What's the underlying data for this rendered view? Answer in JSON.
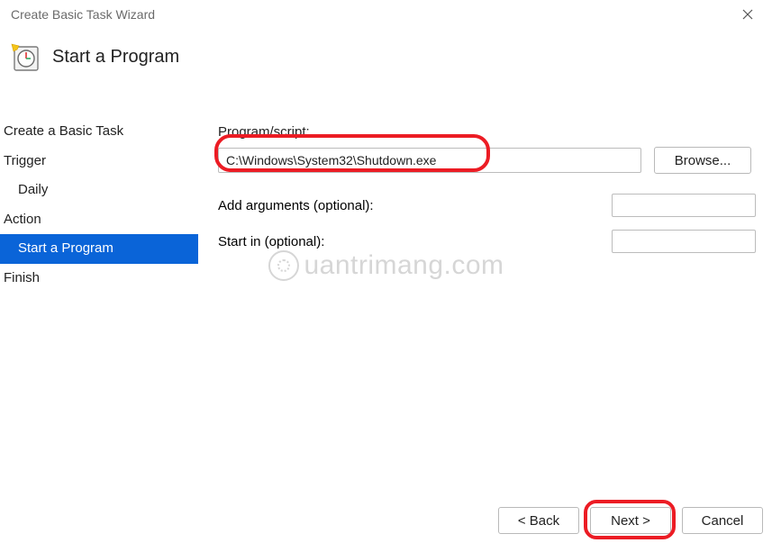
{
  "window": {
    "title": "Create Basic Task Wizard"
  },
  "header": {
    "title": "Start a Program"
  },
  "sidebar": {
    "items": {
      "create": "Create a Basic Task",
      "trigger": "Trigger",
      "trigger_sub": "Daily",
      "action": "Action",
      "action_sub": "Start a Program",
      "finish": "Finish"
    }
  },
  "form": {
    "program_label": "Program/script:",
    "program_value": "C:\\Windows\\System32\\Shutdown.exe",
    "browse_label": "Browse...",
    "arguments_label": "Add arguments (optional):",
    "arguments_value": "",
    "startin_label": "Start in (optional):",
    "startin_value": ""
  },
  "footer": {
    "back": "< Back",
    "next": "Next >",
    "cancel": "Cancel"
  },
  "watermark": {
    "text": "uantrimang.com"
  },
  "highlight_color": "#ec1c24"
}
